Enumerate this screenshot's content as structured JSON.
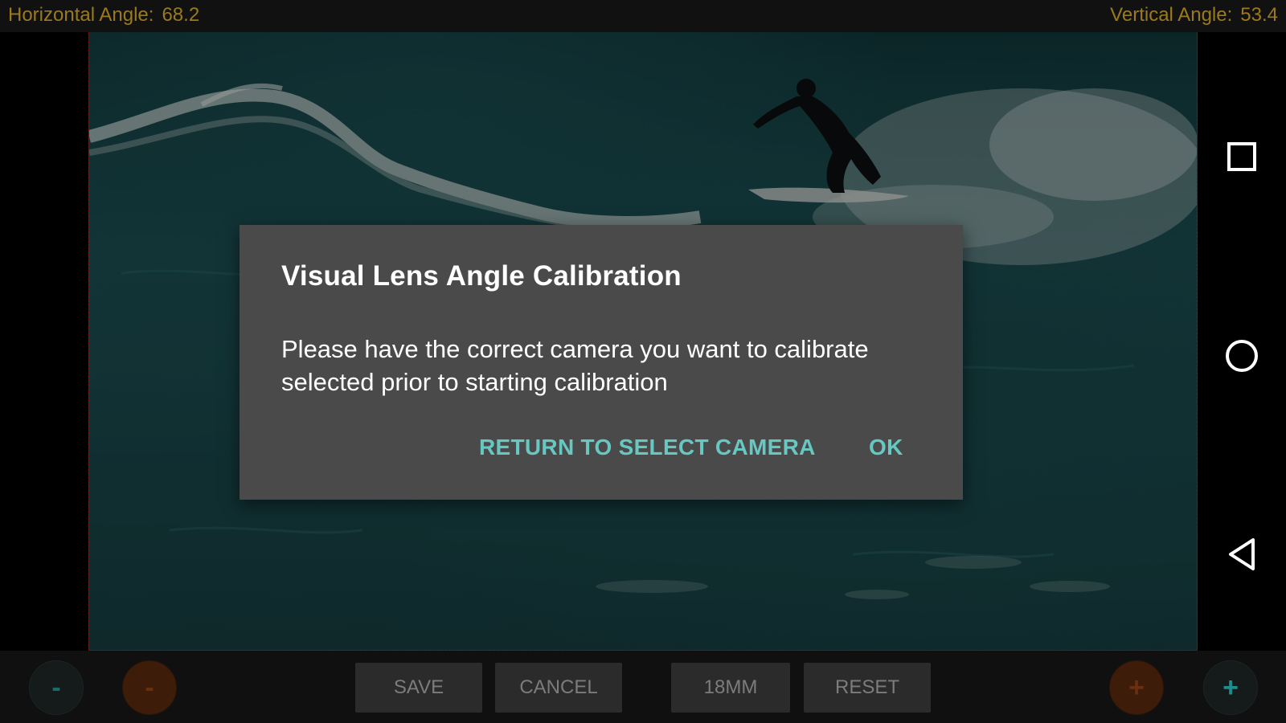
{
  "status_bar": {
    "horizontal_label": "Horizontal Angle:",
    "horizontal_value": "68.2",
    "vertical_label": "Vertical Angle:",
    "vertical_value": "53.4"
  },
  "dialog": {
    "title": "Visual Lens Angle Calibration",
    "message": "Please have the correct camera you want to calibrate selected prior to starting calibration",
    "actions": {
      "return_label": "RETURN TO SELECT CAMERA",
      "ok_label": "OK"
    }
  },
  "toolbar": {
    "minus_fine_label": "-",
    "minus_coarse_label": "-",
    "save_label": "SAVE",
    "cancel_label": "CANCEL",
    "lens_label": "18MM",
    "reset_label": "RESET",
    "plus_coarse_label": "+",
    "plus_fine_label": "+"
  },
  "nav": {
    "icons": [
      "recents-square-icon",
      "home-circle-icon",
      "back-triangle-icon"
    ]
  },
  "colors": {
    "status_text": "#9a7a1c",
    "dialog_bg": "#4a4a4a",
    "dialog_action": "#67c7c1",
    "teal_accent": "#1a8f8c",
    "orange_accent": "#6a2e10"
  }
}
